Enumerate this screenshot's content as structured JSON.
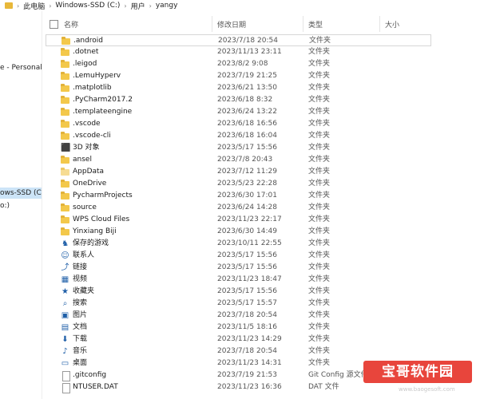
{
  "address": {
    "crumbs": [
      "此电脑",
      "Windows-SSD (C:)",
      "用户",
      "yangy"
    ],
    "separator": "›"
  },
  "nav": {
    "items": [
      {
        "label": "e - Personal"
      },
      {
        "label": "ows-SSD (C:)"
      },
      {
        "label": "o:)"
      }
    ]
  },
  "columns": {
    "name": "名称",
    "date": "修改日期",
    "type": "类型",
    "size": "大小"
  },
  "rows": [
    {
      "name": ".android",
      "date": "2023/7/18 20:54",
      "type": "文件夹",
      "icon": "folder-icon"
    },
    {
      "name": ".dotnet",
      "date": "2023/11/13 23:11",
      "type": "文件夹",
      "icon": "folder-icon"
    },
    {
      "name": ".leigod",
      "date": "2023/8/2 9:08",
      "type": "文件夹",
      "icon": "folder-icon"
    },
    {
      "name": ".LemuHyperv",
      "date": "2023/7/19 21:25",
      "type": "文件夹",
      "icon": "folder-icon"
    },
    {
      "name": ".matplotlib",
      "date": "2023/6/21 13:50",
      "type": "文件夹",
      "icon": "folder-icon"
    },
    {
      "name": ".PyCharm2017.2",
      "date": "2023/6/18 8:32",
      "type": "文件夹",
      "icon": "folder-icon"
    },
    {
      "name": ".templateengine",
      "date": "2023/6/24 13:22",
      "type": "文件夹",
      "icon": "folder-icon"
    },
    {
      "name": ".vscode",
      "date": "2023/6/18 16:56",
      "type": "文件夹",
      "icon": "folder-icon"
    },
    {
      "name": ".vscode-cli",
      "date": "2023/6/18 16:04",
      "type": "文件夹",
      "icon": "folder-icon"
    },
    {
      "name": "3D 对象",
      "date": "2023/5/17 15:56",
      "type": "文件夹",
      "icon": "3d-objects-icon"
    },
    {
      "name": "ansel",
      "date": "2023/7/8 20:43",
      "type": "文件夹",
      "icon": "folder-icon"
    },
    {
      "name": "AppData",
      "date": "2023/7/12 11:29",
      "type": "文件夹",
      "icon": "folder-pale-icon"
    },
    {
      "name": "OneDrive",
      "date": "2023/5/23 22:28",
      "type": "文件夹",
      "icon": "folder-icon"
    },
    {
      "name": "PycharmProjects",
      "date": "2023/6/30 17:01",
      "type": "文件夹",
      "icon": "folder-icon"
    },
    {
      "name": "source",
      "date": "2023/6/24 14:28",
      "type": "文件夹",
      "icon": "folder-icon"
    },
    {
      "name": "WPS Cloud Files",
      "date": "2023/11/23 22:17",
      "type": "文件夹",
      "icon": "folder-icon"
    },
    {
      "name": "Yinxiang Biji",
      "date": "2023/6/30 14:49",
      "type": "文件夹",
      "icon": "folder-icon"
    },
    {
      "name": "保存的游戏",
      "date": "2023/10/11 22:55",
      "type": "文件夹",
      "icon": "saved-games-icon"
    },
    {
      "name": "联系人",
      "date": "2023/5/17 15:56",
      "type": "文件夹",
      "icon": "contacts-icon"
    },
    {
      "name": "链接",
      "date": "2023/5/17 15:56",
      "type": "文件夹",
      "icon": "links-icon"
    },
    {
      "name": "视频",
      "date": "2023/11/23 18:47",
      "type": "文件夹",
      "icon": "videos-icon"
    },
    {
      "name": "收藏夹",
      "date": "2023/5/17 15:56",
      "type": "文件夹",
      "icon": "favorites-icon"
    },
    {
      "name": "搜索",
      "date": "2023/5/17 15:57",
      "type": "文件夹",
      "icon": "searches-icon"
    },
    {
      "name": "图片",
      "date": "2023/7/18 20:54",
      "type": "文件夹",
      "icon": "pictures-icon"
    },
    {
      "name": "文档",
      "date": "2023/11/5 18:16",
      "type": "文件夹",
      "icon": "documents-icon"
    },
    {
      "name": "下载",
      "date": "2023/11/23 14:29",
      "type": "文件夹",
      "icon": "downloads-icon"
    },
    {
      "name": "音乐",
      "date": "2023/7/18 20:54",
      "type": "文件夹",
      "icon": "music-icon"
    },
    {
      "name": "桌面",
      "date": "2023/11/23 14:31",
      "type": "文件夹",
      "icon": "desktop-icon"
    },
    {
      "name": ".gitconfig",
      "date": "2023/7/19 21:53",
      "type": "Git Config 源文件",
      "icon": "file-icon"
    },
    {
      "name": "NTUSER.DAT",
      "date": "2023/11/23 16:36",
      "type": "DAT 文件",
      "icon": "file-icon"
    }
  ],
  "watermark": {
    "text": "宝哥软件园",
    "subtext": "www.baogesoft.com"
  }
}
